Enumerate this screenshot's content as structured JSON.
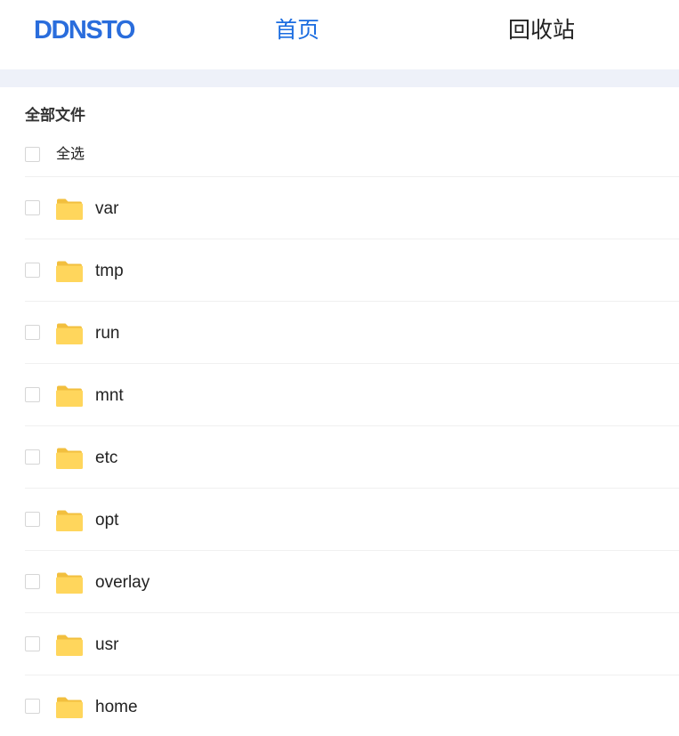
{
  "header": {
    "logo": "DDNSTO",
    "nav": {
      "home_label": "首页",
      "trash_label": "回收站"
    }
  },
  "main": {
    "section_title": "全部文件",
    "select_all_label": "全选",
    "files": [
      {
        "name": "var",
        "type": "folder",
        "checked": false
      },
      {
        "name": "tmp",
        "type": "folder",
        "checked": false
      },
      {
        "name": "run",
        "type": "folder",
        "checked": false
      },
      {
        "name": "mnt",
        "type": "folder",
        "checked": false
      },
      {
        "name": "etc",
        "type": "folder",
        "checked": false
      },
      {
        "name": "opt",
        "type": "folder",
        "checked": false
      },
      {
        "name": "overlay",
        "type": "folder",
        "checked": false
      },
      {
        "name": "usr",
        "type": "folder",
        "checked": false
      },
      {
        "name": "home",
        "type": "folder",
        "checked": false
      }
    ]
  },
  "colors": {
    "brand": "#2a6ddc",
    "nav_active": "#1a6ce0",
    "band": "#eef1f9",
    "folder_front": "#ffd65c",
    "folder_back": "#f2bf3e"
  },
  "icons": {
    "folder": "folder-icon",
    "checkbox": "checkbox-icon"
  }
}
